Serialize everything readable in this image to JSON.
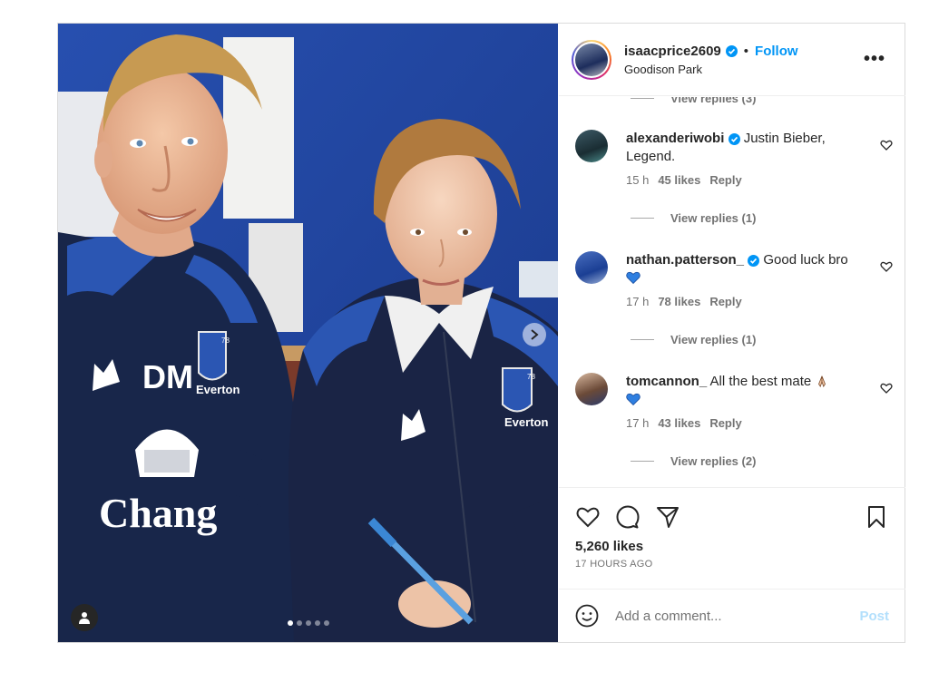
{
  "post": {
    "username": "isaacprice2609",
    "separator": "•",
    "follow_label": "Follow",
    "location": "Goodison Park",
    "more_label": "•••",
    "carousel": {
      "slide_count": 5,
      "active_index": 0
    },
    "photo_text": {
      "shirt_initials": "DM",
      "sponsor": "Chang",
      "club_left": "Everton",
      "club_right": "Everton",
      "crest_year_left": "78",
      "crest_year_right": "78"
    }
  },
  "comments": {
    "top_view_replies": "View replies (3)",
    "items": [
      {
        "user": "alexanderiwobi",
        "verified": true,
        "text": "Justin Bieber, Legend.",
        "emoji": "",
        "time": "15 h",
        "likes": "45 likes",
        "reply": "Reply",
        "view_replies": "View replies (1)"
      },
      {
        "user": "nathan.patterson_",
        "verified": true,
        "text": "Good luck bro",
        "emoji": "blue-heart",
        "time": "17 h",
        "likes": "78 likes",
        "reply": "Reply",
        "view_replies": "View replies (1)"
      },
      {
        "user": "tomcannon_",
        "verified": false,
        "text": "All the best mate",
        "emoji": "praying-hands,blue-heart",
        "time": "17 h",
        "likes": "43 likes",
        "reply": "Reply",
        "view_replies": "View replies (2)"
      }
    ]
  },
  "actions": {
    "likes": "5,260 likes",
    "posted_ago": "17 HOURS AGO"
  },
  "add_comment": {
    "placeholder": "Add a comment...",
    "post_label": "Post"
  },
  "colors": {
    "accent": "#0095f6",
    "post_disabled": "#b2dffc",
    "everton_blue": "#1b3f94",
    "navy": "#18264a"
  }
}
